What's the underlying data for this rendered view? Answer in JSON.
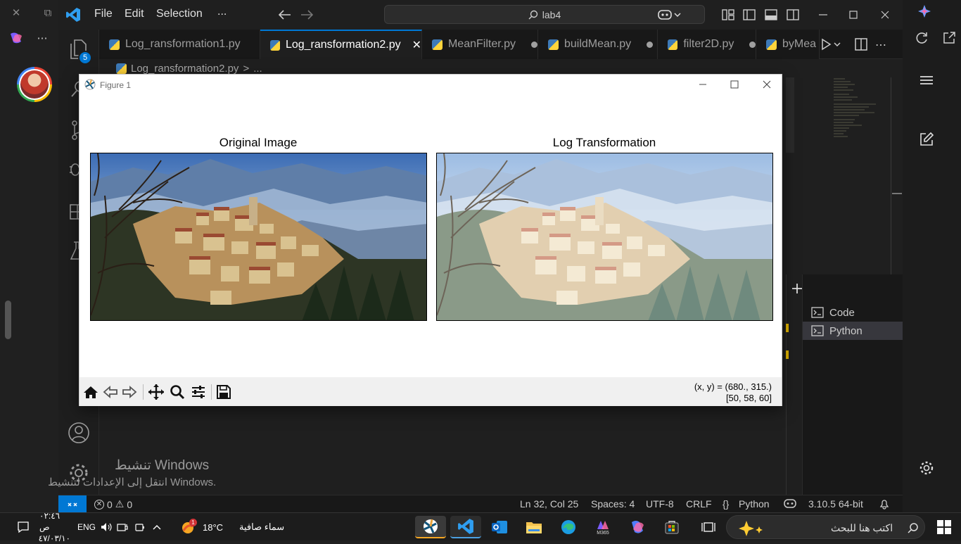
{
  "browser_strip": {
    "close_glyph": "✕",
    "tabs_glyph": "⧉",
    "more_glyph": "⋯"
  },
  "titlebar": {
    "menus": [
      "File",
      "Edit",
      "Selection",
      "..."
    ],
    "search_text": "lab4",
    "accent_color": "#0078d4"
  },
  "activity": {
    "badge_count": "5"
  },
  "tabs": [
    {
      "label": "Log_ransformation1.py",
      "active": false,
      "dirty": false
    },
    {
      "label": "Log_ransformation2.py",
      "active": true,
      "dirty": false
    },
    {
      "label": "MeanFilter.py",
      "active": false,
      "dirty": true
    },
    {
      "label": "buildMean.py",
      "active": false,
      "dirty": true
    },
    {
      "label": "filter2D.py",
      "active": false,
      "dirty": true
    },
    {
      "label": "byMea",
      "active": false,
      "dirty": false
    }
  ],
  "tab_close_glyph": "✕",
  "breadcrumb": {
    "file": "Log_ransformation2.py",
    "sep": ">",
    "rest": "..."
  },
  "terminal_list": [
    {
      "label": "Code",
      "selected": false
    },
    {
      "label": "Python",
      "selected": true
    }
  ],
  "statusbar": {
    "errors": "0",
    "warnings": "0",
    "position": "Ln 32, Col 25",
    "spaces": "Spaces: 4",
    "encoding": "UTF-8",
    "eol": "CRLF",
    "braces": "{}",
    "language": "Python",
    "interpreter": "3.10.5 64-bit"
  },
  "figure": {
    "window_title": "Figure 1",
    "left_title": "Original Image",
    "right_title": "Log Transformation",
    "coord_line1": "(x, y) = (680., 315.)",
    "coord_line2": "[50, 58, 60]"
  },
  "watermark": {
    "line1": "تنشيط Windows",
    "line2": "انتقل إلى الإعدادات لتنشيط Windows."
  },
  "taskbar": {
    "time": "٠٢:٤٦ ص",
    "date": "٤٧/٠٣/١٠",
    "lang": "ENG",
    "temperature": "18°C",
    "weather": "سماء صافية",
    "weather_badge": "1",
    "search_placeholder": "اكتب هنا للبحث",
    "m365_label": "M365"
  }
}
